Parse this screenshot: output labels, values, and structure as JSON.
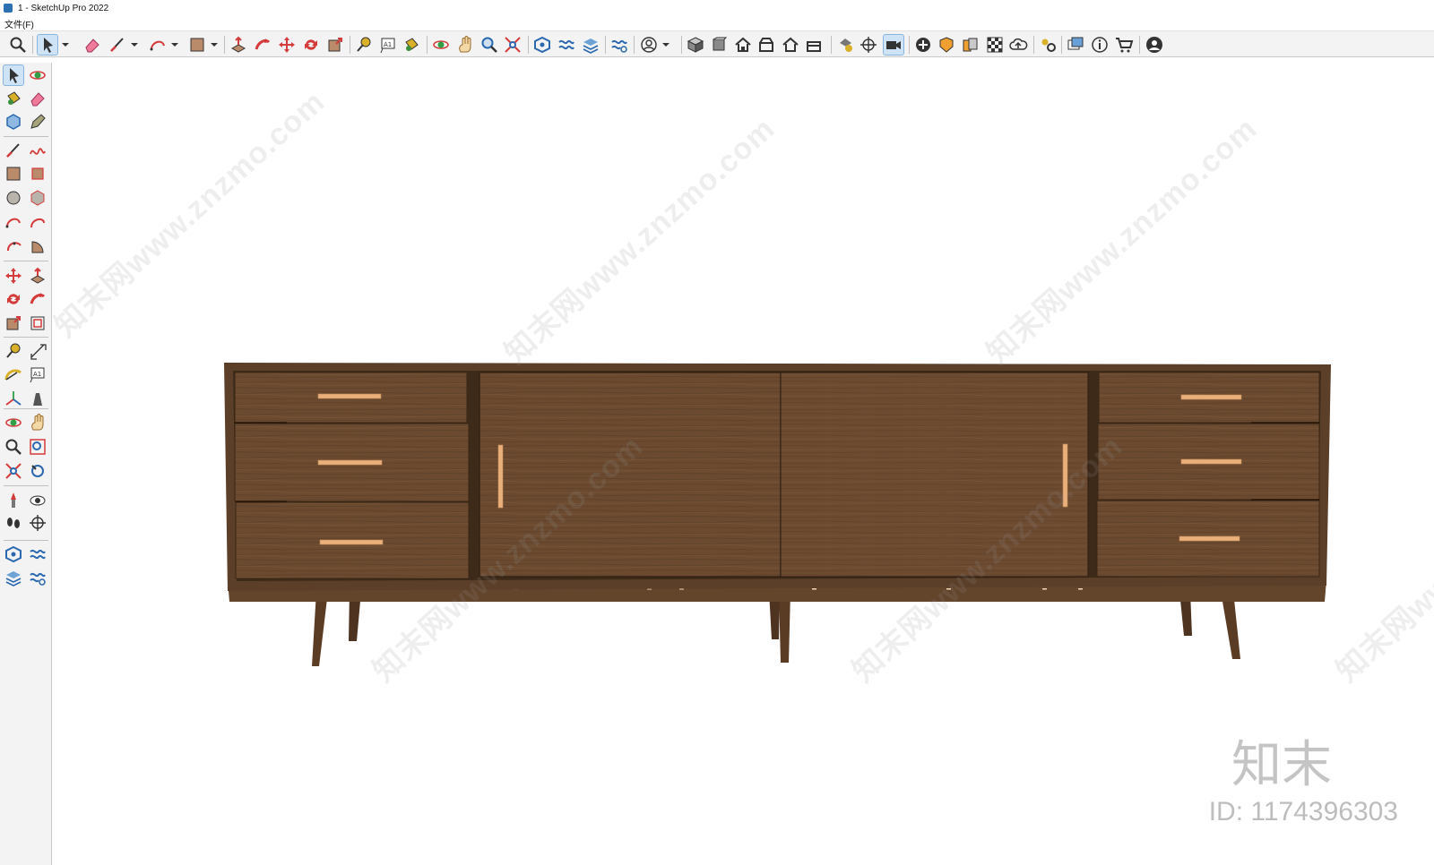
{
  "window": {
    "title": "1 - SketchUp Pro 2022"
  },
  "menu": {
    "file": "文件(F)"
  },
  "top_toolbar": {
    "tools": [
      "zoom-icon",
      "select-icon",
      "dropdown",
      "eraser-icon",
      "line-icon",
      "dropdown",
      "arc-icon",
      "dropdown",
      "rectangle-icon",
      "dropdown",
      "push-pull-icon",
      "follow-me-icon",
      "move-icon",
      "rotate-icon",
      "scale-icon",
      "tape-measure-icon",
      "text-icon",
      "paint-bucket-icon",
      "orbit-icon",
      "pan-icon",
      "zoom-tool-icon",
      "zoom-extents-icon",
      "warehouse-icon",
      "extension-warehouse-icon",
      "layout-icon",
      "extension-manager-icon",
      "profile-icon",
      "dropdown",
      "iso-view-icon",
      "top-view-icon",
      "front-view-icon",
      "right-view-icon",
      "back-view-icon",
      "left-view-icon",
      "solid-tools-icon",
      "section-plane-icon",
      "camera-icon",
      "add-location-icon",
      "sandbox-icon",
      "styles-icon",
      "shadows-icon",
      "cloud-icon",
      "settings-icon",
      "scenes-icon",
      "info-icon",
      "cart-icon",
      "account-icon"
    ]
  },
  "left_toolbar": {
    "tools": [
      "select-icon",
      "orbit-icon",
      "paint-bucket-icon",
      "eraser-icon",
      "component-icon",
      "tag-icon",
      "line-icon",
      "freehand-icon",
      "rectangle-icon",
      "rotated-rectangle-icon",
      "circle-icon",
      "polygon-icon",
      "arc-icon",
      "two-point-arc-icon",
      "three-point-arc-icon",
      "pie-icon",
      "move-icon",
      "push-pull-icon",
      "rotate-icon",
      "follow-me-icon",
      "scale-icon",
      "offset-icon",
      "tape-measure-icon",
      "dimension-icon",
      "protractor-icon",
      "text-icon",
      "axes-icon",
      "3d-text-icon",
      "orbit-tool-icon",
      "pan-icon",
      "zoom-icon",
      "zoom-window-icon",
      "zoom-extents-icon",
      "previous-view-icon",
      "position-camera-icon",
      "look-around-icon",
      "walk-icon",
      "section-plane-icon",
      "warehouse-icon",
      "extension-warehouse-icon",
      "layout-icon",
      "extension-manager-icon"
    ]
  },
  "colors": {
    "wood_main": "#6b4a30",
    "wood_dark": "#4a321f",
    "handle": "#e9b07c",
    "toolbar_bg": "#f3f3f3",
    "active_tool": "#cfe3f7"
  },
  "watermark": {
    "text": "知末网www.znzmo.com"
  },
  "brand": {
    "logo": "知末",
    "id": "ID: 1174396303"
  }
}
